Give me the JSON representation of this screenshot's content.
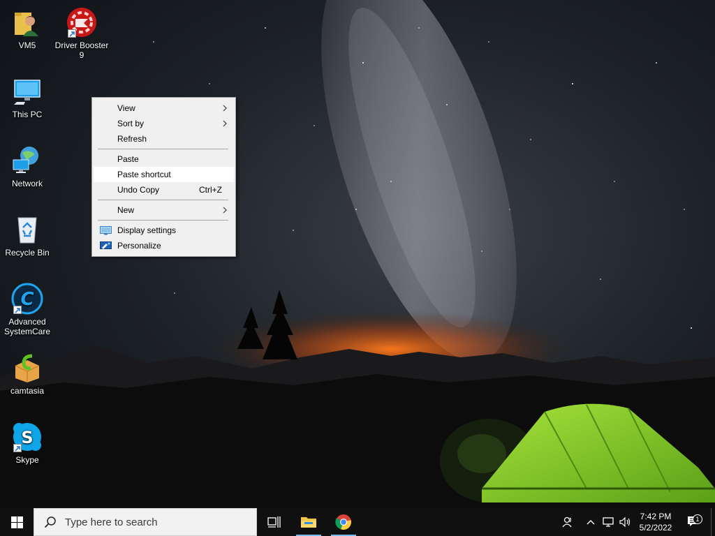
{
  "desktop": {
    "icons": [
      {
        "label": "VM5",
        "icon": "folder-user-icon"
      },
      {
        "label": "Driver Booster 9",
        "icon": "driver-booster-icon",
        "shortcut": true
      },
      {
        "label": "This PC",
        "icon": "this-pc-icon"
      },
      {
        "label": "Network",
        "icon": "network-icon"
      },
      {
        "label": "Recycle Bin",
        "icon": "recycle-bin-icon"
      },
      {
        "label": "Advanced SystemCare",
        "icon": "advanced-systemcare-icon",
        "shortcut": true
      },
      {
        "label": "camtasia",
        "icon": "camtasia-icon"
      },
      {
        "label": "Skype",
        "icon": "skype-icon",
        "shortcut": true
      }
    ]
  },
  "context_menu": {
    "items": [
      {
        "label": "View",
        "submenu": true
      },
      {
        "label": "Sort by",
        "submenu": true
      },
      {
        "label": "Refresh"
      },
      {
        "label": "Paste"
      },
      {
        "label": "Paste shortcut",
        "highlighted": true
      },
      {
        "label": "Undo Copy",
        "shortcut": "Ctrl+Z"
      },
      {
        "label": "New",
        "submenu": true
      },
      {
        "label": "Display settings",
        "icon": "display-settings-icon"
      },
      {
        "label": "Personalize",
        "icon": "personalize-icon"
      }
    ]
  },
  "taskbar": {
    "search_placeholder": "Type here to search",
    "pinned": [
      "task-view-icon",
      "file-explorer-icon",
      "chrome-icon"
    ],
    "tray": [
      "people-icon",
      "chevron-up-icon",
      "network-icon",
      "volume-icon"
    ],
    "clock": {
      "time": "7:42 PM",
      "date": "5/2/2022"
    },
    "notification_count": "1"
  },
  "colors": {
    "taskbar_bg": "#101010",
    "menu_bg": "#f0f0f0",
    "menu_hover": "#ffffff",
    "active_indicator": "#76b9ed",
    "tent_green": "#8fd12e"
  }
}
